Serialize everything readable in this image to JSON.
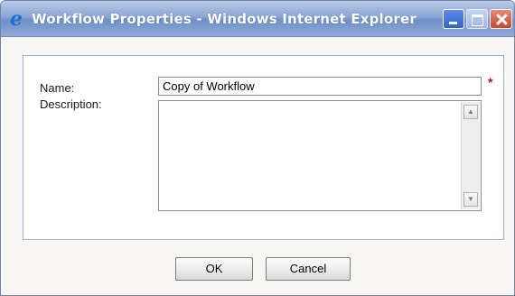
{
  "window": {
    "title": "Workflow Properties - Windows Internet Explorer",
    "title_icon": "ie-logo-icon",
    "controls": [
      "minimize-icon",
      "maximize-icon",
      "close-icon"
    ]
  },
  "form": {
    "name_label": "Name:",
    "name_value": "Copy of Workflow",
    "required_marker": "*",
    "description_label": "Description:",
    "description_value": ""
  },
  "buttons": {
    "ok": "OK",
    "cancel": "Cancel"
  },
  "colors": {
    "titlebar": "#7f9ccf",
    "required": "#d0021b"
  }
}
